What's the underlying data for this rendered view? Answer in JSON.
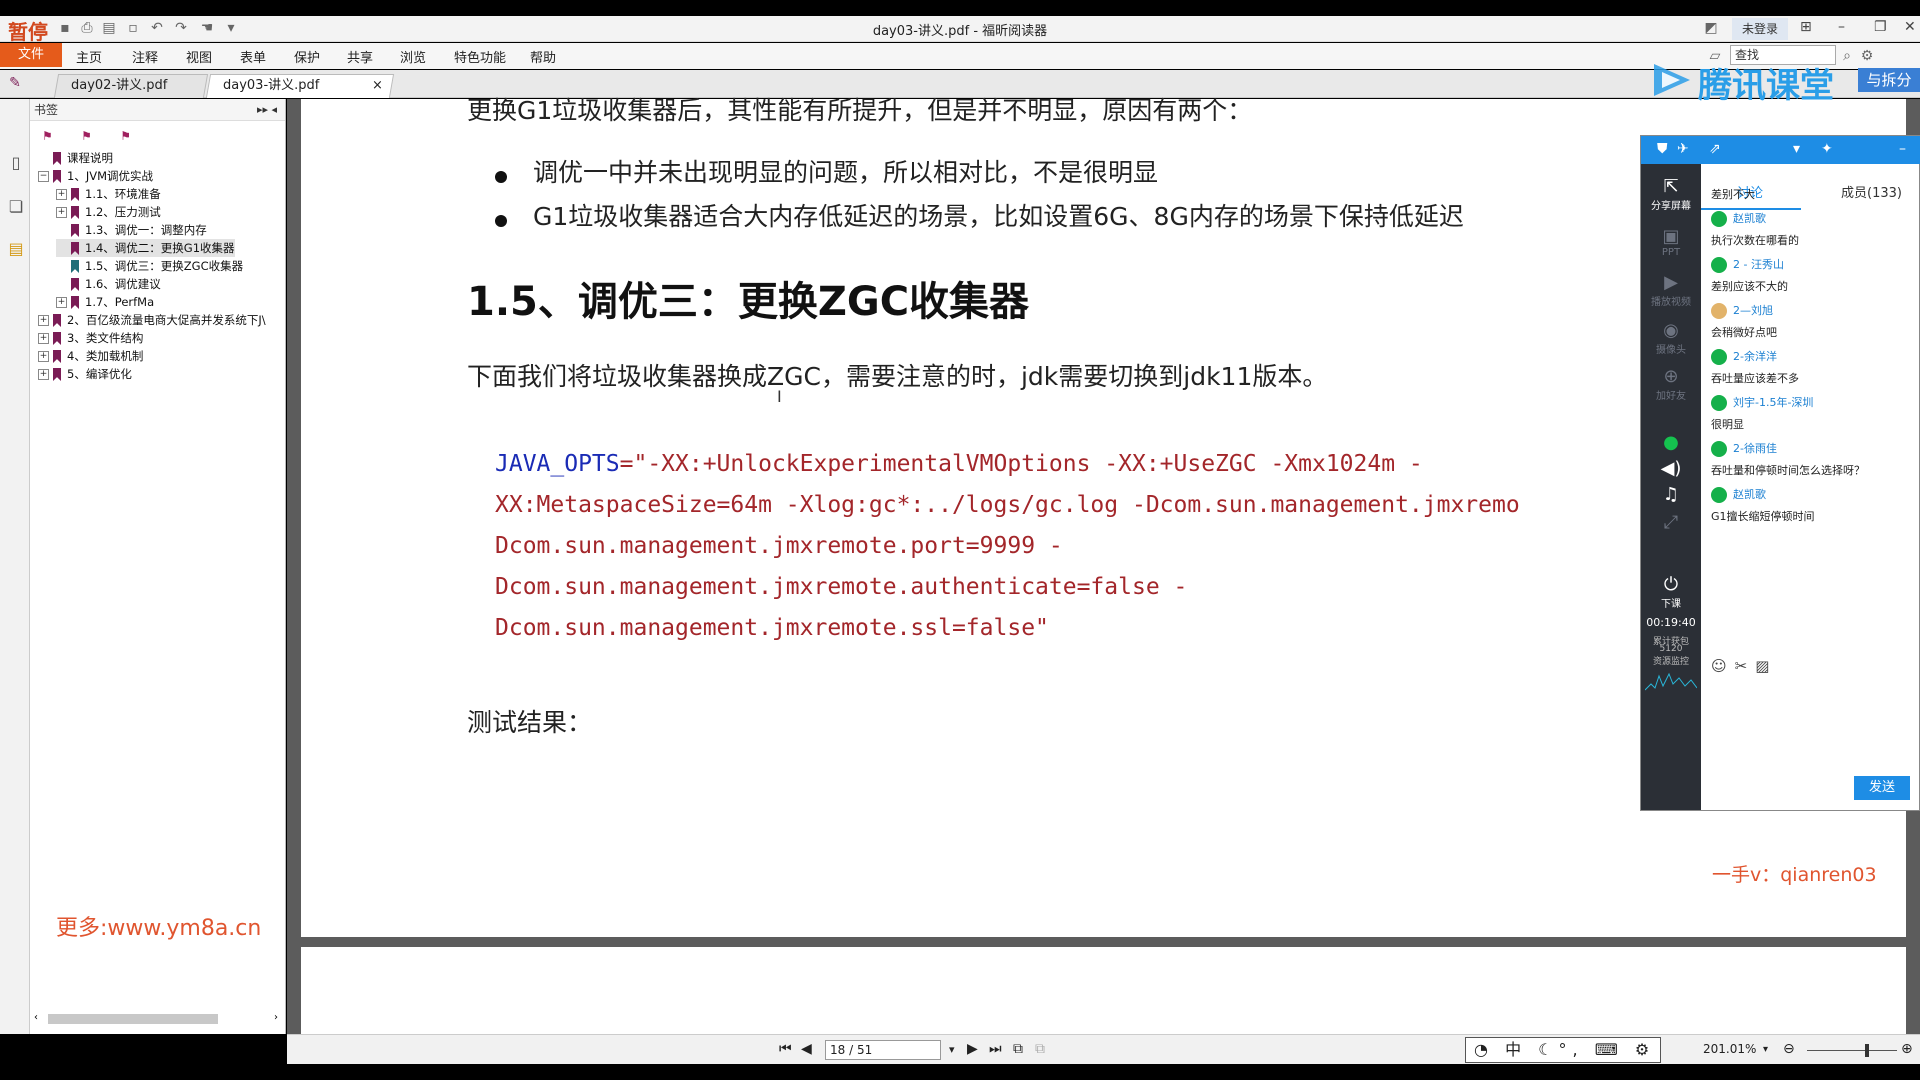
{
  "app": {
    "logo_text": "暂停",
    "window_title": "day03-讲义.pdf - 福昕阅读器",
    "login_label": "未登录",
    "search_label": "查找"
  },
  "menu": {
    "file": "文件",
    "items": [
      "主页",
      "注释",
      "视图",
      "表单",
      "保护",
      "共享",
      "浏览",
      "特色功能",
      "帮助"
    ]
  },
  "tabs": [
    {
      "label": "day02-讲义.pdf"
    },
    {
      "label": "day03-讲义.pdf",
      "close": "×"
    }
  ],
  "bookmarks": {
    "title": "书签",
    "items": [
      {
        "label": "课程说明"
      },
      {
        "label": "1、JVM调优实战"
      },
      {
        "label": "1.1、环境准备"
      },
      {
        "label": "1.2、压力测试"
      },
      {
        "label": "1.3、调优一：调整内存"
      },
      {
        "label": "1.4、调优二：更换G1收集器"
      },
      {
        "label": "1.5、调优三：更换ZGC收集器"
      },
      {
        "label": "1.6、调优建议"
      },
      {
        "label": "1.7、PerfMa"
      },
      {
        "label": "2、百亿级流量电商大促高并发系统下J\\"
      },
      {
        "label": "3、类文件结构"
      },
      {
        "label": "4、类加载机制"
      },
      {
        "label": "5、编译优化"
      }
    ]
  },
  "watermark_left": "更多:www.ym8a.cn",
  "document": {
    "intro_line": "更换G1垃圾收集器后，其性能有所提升，但是并不明显，原因有两个：",
    "bullets": [
      "调优一中并未出现明显的问题，所以相对比，不是很明显",
      "G1垃圾收集器适合大内存低延迟的场景，比如设置6G、8G内存的场景下保持低延迟"
    ],
    "heading": "1.5、调优三：更换ZGC收集器",
    "paragraph": "下面我们将垃圾收集器换成ZGC，需要注意的时，jdk需要切换到jdk11版本。",
    "code_key": "JAVA_OPTS",
    "code_lines": [
      "=\"-XX:+UnlockExperimentalVMOptions -XX:+UseZGC -Xmx1024m -",
      "XX:MetaspaceSize=64m -Xlog:gc*:../logs/gc.log -Dcom.sun.management.jmxremo",
      "Dcom.sun.management.jmxremote.port=9999 -",
      "Dcom.sun.management.jmxremote.authenticate=false -",
      "Dcom.sun.management.jmxremote.ssl=false\""
    ],
    "result_label": "测试结果："
  },
  "status": {
    "page_field": "18 / 51",
    "ime_text": "中",
    "zoom": "201.01%"
  },
  "tencent": {
    "brand": "腾讯课堂",
    "split_label": "与拆分",
    "share_label": "分享屏幕",
    "ppt_label": "PPT",
    "video_label": "播放视频",
    "camera_label": "摄像头",
    "addfriend_label": "加好友",
    "end_label": "下课",
    "timer": "00:19:40",
    "gift_label": "累计获包",
    "gift_count": "5120",
    "monitor_label": "资源监控",
    "tab_discuss": "讨论",
    "tab_members": "成员(133)",
    "messages": [
      {
        "text": "差别不大"
      },
      {
        "name": "赵凯歌",
        "text": "执行次数在哪看的"
      },
      {
        "name": "2 - 汪秀山",
        "text": "差别应该不大的"
      },
      {
        "name": "2—刘旭",
        "text": "会稍微好点吧"
      },
      {
        "name": "2-余洋洋",
        "text": "吞吐量应该差不多"
      },
      {
        "name": "刘宇-1.5年-深圳",
        "text": "很明显"
      },
      {
        "name": "2-徐雨佳",
        "text": "吞吐量和停顿时间怎么选择呀？"
      },
      {
        "name": "赵凯歌",
        "text": "G1擅长缩短停顿时间"
      }
    ],
    "send_label": "发送"
  },
  "watermark_right": "一手v：qianren03"
}
